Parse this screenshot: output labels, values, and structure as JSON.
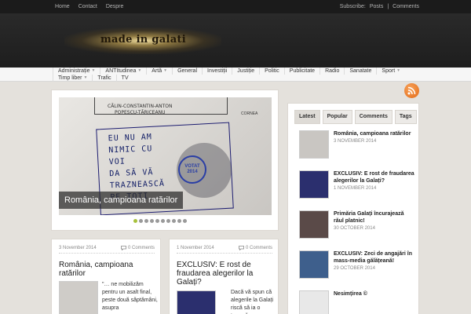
{
  "topnav": {
    "items": [
      "Home",
      "Contact",
      "Despre"
    ],
    "subscribe_label": "Subscribe:",
    "posts": "Posts",
    "separator": "|",
    "comments": "Comments"
  },
  "logo": {
    "text": "made in galati"
  },
  "mainnav": {
    "row1": [
      {
        "label": "Administrație",
        "dropdown": true
      },
      {
        "label": "ANTItudinea",
        "dropdown": true
      },
      {
        "label": "Artă",
        "dropdown": true
      },
      {
        "label": "General",
        "dropdown": false
      },
      {
        "label": "Investiții",
        "dropdown": false
      },
      {
        "label": "Justiție",
        "dropdown": false
      },
      {
        "label": "Politic",
        "dropdown": false
      },
      {
        "label": "Publicitate",
        "dropdown": false
      },
      {
        "label": "Radio",
        "dropdown": false
      },
      {
        "label": "Sanatate",
        "dropdown": false
      },
      {
        "label": "Sport",
        "dropdown": true
      }
    ],
    "row2": [
      {
        "label": "Timp liber",
        "dropdown": true
      },
      {
        "label": "Trafic",
        "dropdown": false
      },
      {
        "label": "TV",
        "dropdown": false
      }
    ]
  },
  "slider": {
    "caption": "România, campioana ratărilor",
    "ballot_header": "CĂLIN-CONSTANTIN-ANTON\nPOPESCU-TĂRICEANU",
    "ballot_corner": "CORNEA",
    "scrawl": "EU NU AM\nNIMIC CU\nVOI\nDA SĂ VĂ\nTRAZNEASCĂ\nPE TOȚI",
    "stamp": "VOTAT\n2014",
    "dot_count": 10,
    "active_dot": 0
  },
  "sidebar": {
    "tabs": [
      "Latest",
      "Popular",
      "Comments",
      "Tags"
    ],
    "active_tab": 0,
    "items": [
      {
        "title": "România, campioana ratărilor",
        "date": "3 NOVEMBER 2014",
        "thumb": "#c9c6c2"
      },
      {
        "title": "EXCLUSIV: E rost de fraudarea alegerilor la Galați?",
        "date": "1 NOVEMBER 2014",
        "thumb": "#2b2f6e"
      },
      {
        "title": "Primăria Galați încurajează răul platnic!",
        "date": "30 OCTOBER 2014",
        "thumb": "#5a4a48"
      },
      {
        "title": "EXCLUSIV: Zeci de angajări în mass-media gălățeană!",
        "date": "29 OCTOBER 2014",
        "thumb": "#3e5f8c"
      },
      {
        "title": "Nesimțirea ©",
        "date": "",
        "thumb": "#e8e8e8"
      }
    ]
  },
  "posts": [
    {
      "date": "3 November 2014",
      "comments": "0 Comments",
      "title": "România, campioana ratărilor",
      "excerpt": "\"… ne mobilizăm pentru un asalt final, peste două săptămâni, asupra",
      "thumb": "#cfccc8"
    },
    {
      "date": "1 November 2014",
      "comments": "0 Comments",
      "title": "EXCLUSIV: E rost de fraudarea alegerilor la Galați?",
      "excerpt": "Dacă vă spun că alegerile la Galați riscă să ia o turnură",
      "thumb": "#2b2f6e"
    }
  ],
  "colors": {
    "topbar": "#1b1b1b",
    "background": "#e4e1dc",
    "accent_dot": "#a7c13c",
    "rss": "#e36a16"
  }
}
